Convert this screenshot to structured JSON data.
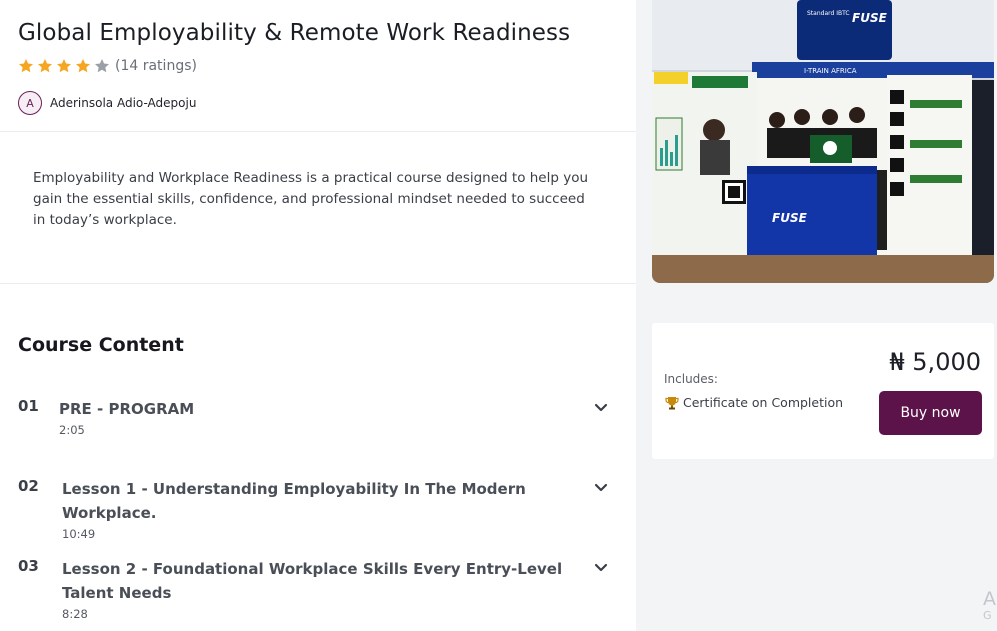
{
  "course": {
    "title": "Global Employability & Remote Work Readiness",
    "rating_stars": 4,
    "rating_max": 5,
    "ratings_count_text": "(14 ratings)",
    "author_initial": "A",
    "author_name": "Aderinsola Adio-Adepoju",
    "description": "Employability and Workplace Readiness is a practical course designed to help you gain the essential skills, confidence, and professional mindset needed to succeed in today’s workplace."
  },
  "content": {
    "heading": "Course Content",
    "lessons": [
      {
        "number": "01",
        "title": "PRE - PROGRAM",
        "duration": "2:05"
      },
      {
        "number": "02",
        "title": "Lesson 1 - Understanding Employability In The Modern Workplace.",
        "duration": "10:49"
      },
      {
        "number": "03",
        "title": "Lesson 2 - Foundational Workplace Skills Every Entry-Level Talent Needs",
        "duration": "8:28"
      }
    ]
  },
  "hero_image": {
    "banner_top": "Standard IBTC",
    "banner_brand": "FUSE",
    "banner_strip": "I-TRAIN AFRICA",
    "podium_brand": "FUSE"
  },
  "purchase": {
    "price": "₦ 5,000",
    "includes_label": "Includes:",
    "certificate_label": "Certificate on Completion",
    "buy_label": "Buy now"
  },
  "overlay": {
    "line1": "A",
    "line2": "G"
  },
  "colors": {
    "brand": "#5b1349",
    "star": "#f5a623",
    "star_empty": "#9aa0a6"
  },
  "icons": [
    "star-icon",
    "chevron-down-icon",
    "trophy-icon"
  ]
}
